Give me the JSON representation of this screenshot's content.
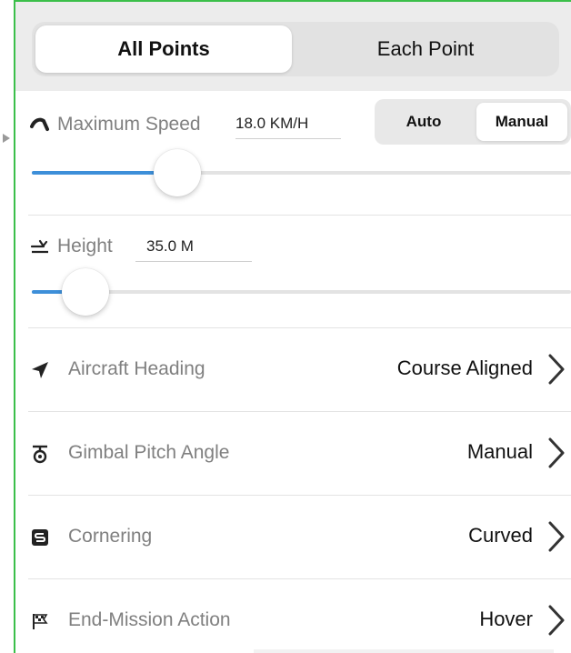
{
  "tabs": {
    "all_points": "All Points",
    "each_point": "Each Point"
  },
  "speed": {
    "label": "Maximum Speed",
    "value": "18.0 KM/H",
    "level": 0.27,
    "mode_auto": "Auto",
    "mode_manual": "Manual",
    "selected_mode": "Manual"
  },
  "height": {
    "label": "Height",
    "value": "35.0 M",
    "level": 0.1
  },
  "rows": [
    {
      "icon": "heading-arrow-icon",
      "label": "Aircraft Heading",
      "value": "Course Aligned"
    },
    {
      "icon": "gimbal-icon",
      "label": "Gimbal Pitch Angle",
      "value": "Manual"
    },
    {
      "icon": "cornering-icon",
      "label": "Cornering",
      "value": "Curved"
    },
    {
      "icon": "checkered-flag-icon",
      "label": "End-Mission Action",
      "value": "Hover"
    }
  ],
  "colors": {
    "accent": "#3d8fd9",
    "frame": "#3bbf4a",
    "label": "#808080"
  }
}
